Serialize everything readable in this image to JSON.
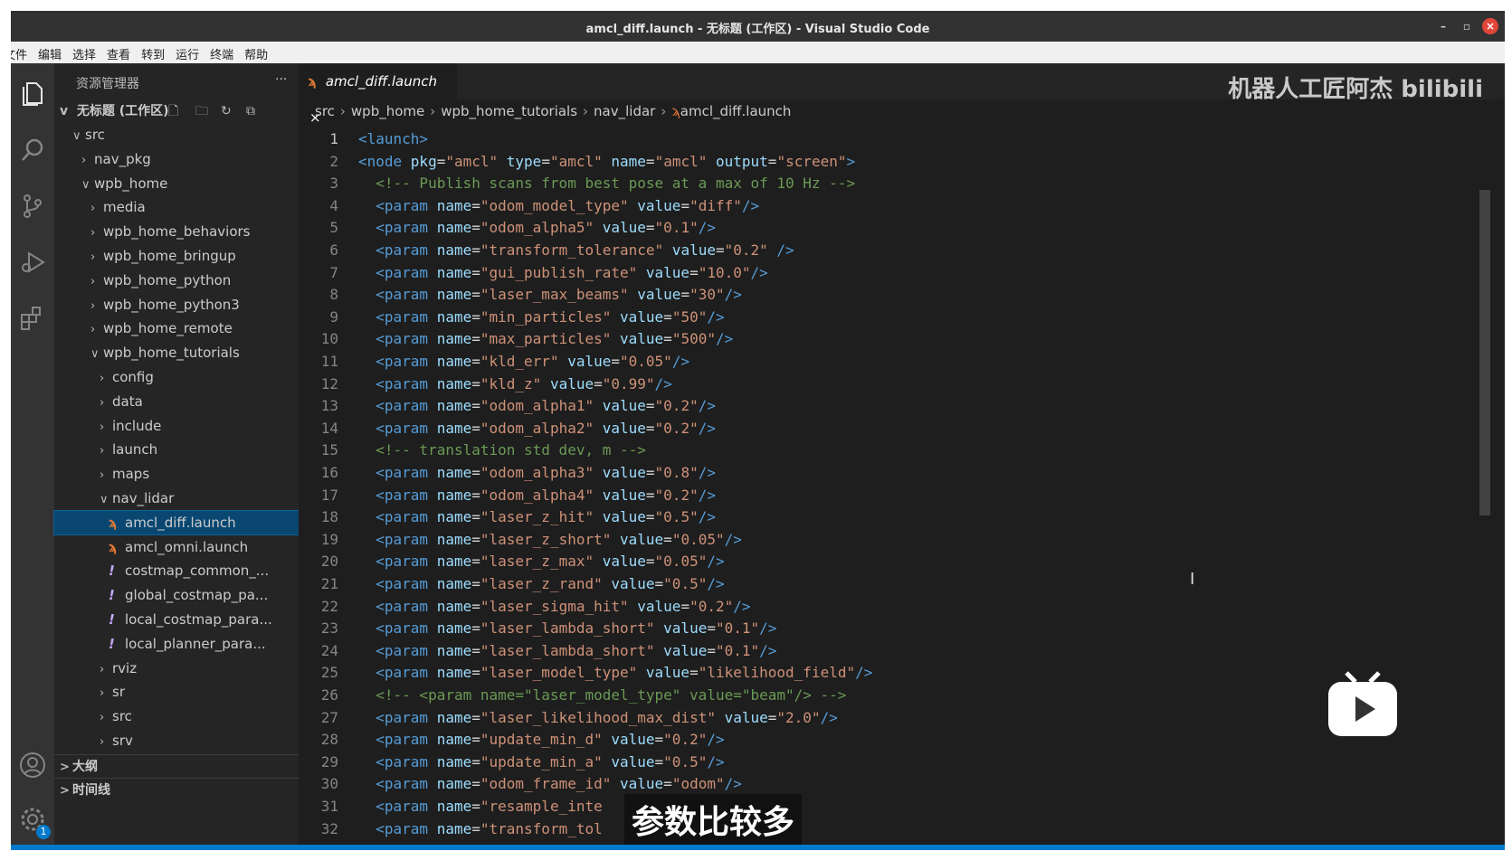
{
  "window": {
    "title": "amcl_diff.launch - 无标题 (工作区) - Visual Studio Code"
  },
  "menubar": {
    "items": [
      "文件",
      "编辑",
      "选择",
      "查看",
      "转到",
      "运行",
      "终端",
      "帮助"
    ]
  },
  "sidebar": {
    "title": "资源管理器",
    "more": "···",
    "workspace": "无标题 (工作区)",
    "tree": [
      {
        "label": "src",
        "chev": "v",
        "indent": 1
      },
      {
        "label": "nav_pkg",
        "chev": ">",
        "indent": 2
      },
      {
        "label": "wpb_home",
        "chev": "v",
        "indent": 2
      },
      {
        "label": "media",
        "chev": ">",
        "indent": 3
      },
      {
        "label": "wpb_home_behaviors",
        "chev": ">",
        "indent": 3
      },
      {
        "label": "wpb_home_bringup",
        "chev": ">",
        "indent": 3
      },
      {
        "label": "wpb_home_python",
        "chev": ">",
        "indent": 3
      },
      {
        "label": "wpb_home_python3",
        "chev": ">",
        "indent": 3
      },
      {
        "label": "wpb_home_remote",
        "chev": ">",
        "indent": 3
      },
      {
        "label": "wpb_home_tutorials",
        "chev": "v",
        "indent": 3
      },
      {
        "label": "config",
        "chev": ">",
        "indent": 4
      },
      {
        "label": "data",
        "chev": ">",
        "indent": 4
      },
      {
        "label": "include",
        "chev": ">",
        "indent": 4
      },
      {
        "label": "launch",
        "chev": ">",
        "indent": 4
      },
      {
        "label": "maps",
        "chev": ">",
        "indent": 4
      },
      {
        "label": "nav_lidar",
        "chev": "v",
        "indent": 4
      },
      {
        "label": "amcl_diff.launch",
        "icon": "rss",
        "indent": 5,
        "selected": true
      },
      {
        "label": "amcl_omni.launch",
        "icon": "rss",
        "indent": 5
      },
      {
        "label": "costmap_common_...",
        "icon": "!",
        "indent": 5
      },
      {
        "label": "global_costmap_pa...",
        "icon": "!",
        "indent": 5
      },
      {
        "label": "local_costmap_para...",
        "icon": "!",
        "indent": 5
      },
      {
        "label": "local_planner_para...",
        "icon": "!",
        "indent": 5
      },
      {
        "label": "rviz",
        "chev": ">",
        "indent": 4
      },
      {
        "label": "sr",
        "chev": ">",
        "indent": 4
      },
      {
        "label": "src",
        "chev": ">",
        "indent": 4
      },
      {
        "label": "srv",
        "chev": ">",
        "indent": 4
      }
    ],
    "outline": "大纲",
    "timeline": "时间线"
  },
  "activity": {
    "badge": "1"
  },
  "editor": {
    "tab_label": "amcl_diff.launch",
    "tab_close": "×",
    "breadcrumb": [
      "src",
      "wpb_home",
      "wpb_home_tutorials",
      "nav_lidar",
      "amcl_diff.launch"
    ],
    "lines": [
      [
        [
          "tg",
          "<launch>"
        ]
      ],
      [
        [
          "tg",
          "<node "
        ],
        [
          "at",
          "pkg"
        ],
        [
          "eq",
          "="
        ],
        [
          "st",
          "\"amcl\""
        ],
        [
          "at",
          " type"
        ],
        [
          "eq",
          "="
        ],
        [
          "st",
          "\"amcl\""
        ],
        [
          "at",
          " name"
        ],
        [
          "eq",
          "="
        ],
        [
          "st",
          "\"amcl\""
        ],
        [
          "at",
          " output"
        ],
        [
          "eq",
          "="
        ],
        [
          "st",
          "\"screen\""
        ],
        [
          "tg",
          ">"
        ]
      ],
      [
        [
          "cm",
          "  <!-- Publish scans from best pose at a max of 10 Hz -->"
        ]
      ],
      [
        [
          "tg",
          "  <param "
        ],
        [
          "at",
          "name"
        ],
        [
          "eq",
          "="
        ],
        [
          "st",
          "\"odom_model_type\""
        ],
        [
          "at",
          " value"
        ],
        [
          "eq",
          "="
        ],
        [
          "st",
          "\"diff\""
        ],
        [
          "tg",
          "/>"
        ]
      ],
      [
        [
          "tg",
          "  <param "
        ],
        [
          "at",
          "name"
        ],
        [
          "eq",
          "="
        ],
        [
          "st",
          "\"odom_alpha5\""
        ],
        [
          "at",
          " value"
        ],
        [
          "eq",
          "="
        ],
        [
          "st",
          "\"0.1\""
        ],
        [
          "tg",
          "/>"
        ]
      ],
      [
        [
          "tg",
          "  <param "
        ],
        [
          "at",
          "name"
        ],
        [
          "eq",
          "="
        ],
        [
          "st",
          "\"transform_tolerance\""
        ],
        [
          "at",
          " value"
        ],
        [
          "eq",
          "="
        ],
        [
          "st",
          "\"0.2\""
        ],
        [
          "tg",
          " />"
        ]
      ],
      [
        [
          "tg",
          "  <param "
        ],
        [
          "at",
          "name"
        ],
        [
          "eq",
          "="
        ],
        [
          "st",
          "\"gui_publish_rate\""
        ],
        [
          "at",
          " value"
        ],
        [
          "eq",
          "="
        ],
        [
          "st",
          "\"10.0\""
        ],
        [
          "tg",
          "/>"
        ]
      ],
      [
        [
          "tg",
          "  <param "
        ],
        [
          "at",
          "name"
        ],
        [
          "eq",
          "="
        ],
        [
          "st",
          "\"laser_max_beams\""
        ],
        [
          "at",
          " value"
        ],
        [
          "eq",
          "="
        ],
        [
          "st",
          "\"30\""
        ],
        [
          "tg",
          "/>"
        ]
      ],
      [
        [
          "tg",
          "  <param "
        ],
        [
          "at",
          "name"
        ],
        [
          "eq",
          "="
        ],
        [
          "st",
          "\"min_particles\""
        ],
        [
          "at",
          " value"
        ],
        [
          "eq",
          "="
        ],
        [
          "st",
          "\"50\""
        ],
        [
          "tg",
          "/>"
        ]
      ],
      [
        [
          "tg",
          "  <param "
        ],
        [
          "at",
          "name"
        ],
        [
          "eq",
          "="
        ],
        [
          "st",
          "\"max_particles\""
        ],
        [
          "at",
          " value"
        ],
        [
          "eq",
          "="
        ],
        [
          "st",
          "\"500\""
        ],
        [
          "tg",
          "/>"
        ]
      ],
      [
        [
          "tg",
          "  <param "
        ],
        [
          "at",
          "name"
        ],
        [
          "eq",
          "="
        ],
        [
          "st",
          "\"kld_err\""
        ],
        [
          "at",
          " value"
        ],
        [
          "eq",
          "="
        ],
        [
          "st",
          "\"0.05\""
        ],
        [
          "tg",
          "/>"
        ]
      ],
      [
        [
          "tg",
          "  <param "
        ],
        [
          "at",
          "name"
        ],
        [
          "eq",
          "="
        ],
        [
          "st",
          "\"kld_z\""
        ],
        [
          "at",
          " value"
        ],
        [
          "eq",
          "="
        ],
        [
          "st",
          "\"0.99\""
        ],
        [
          "tg",
          "/>"
        ]
      ],
      [
        [
          "tg",
          "  <param "
        ],
        [
          "at",
          "name"
        ],
        [
          "eq",
          "="
        ],
        [
          "st",
          "\"odom_alpha1\""
        ],
        [
          "at",
          " value"
        ],
        [
          "eq",
          "="
        ],
        [
          "st",
          "\"0.2\""
        ],
        [
          "tg",
          "/>"
        ]
      ],
      [
        [
          "tg",
          "  <param "
        ],
        [
          "at",
          "name"
        ],
        [
          "eq",
          "="
        ],
        [
          "st",
          "\"odom_alpha2\""
        ],
        [
          "at",
          " value"
        ],
        [
          "eq",
          "="
        ],
        [
          "st",
          "\"0.2\""
        ],
        [
          "tg",
          "/>"
        ]
      ],
      [
        [
          "cm",
          "  <!-- translation std dev, m -->"
        ]
      ],
      [
        [
          "tg",
          "  <param "
        ],
        [
          "at",
          "name"
        ],
        [
          "eq",
          "="
        ],
        [
          "st",
          "\"odom_alpha3\""
        ],
        [
          "at",
          " value"
        ],
        [
          "eq",
          "="
        ],
        [
          "st",
          "\"0.8\""
        ],
        [
          "tg",
          "/>"
        ]
      ],
      [
        [
          "tg",
          "  <param "
        ],
        [
          "at",
          "name"
        ],
        [
          "eq",
          "="
        ],
        [
          "st",
          "\"odom_alpha4\""
        ],
        [
          "at",
          " value"
        ],
        [
          "eq",
          "="
        ],
        [
          "st",
          "\"0.2\""
        ],
        [
          "tg",
          "/>"
        ]
      ],
      [
        [
          "tg",
          "  <param "
        ],
        [
          "at",
          "name"
        ],
        [
          "eq",
          "="
        ],
        [
          "st",
          "\"laser_z_hit\""
        ],
        [
          "at",
          " value"
        ],
        [
          "eq",
          "="
        ],
        [
          "st",
          "\"0.5\""
        ],
        [
          "tg",
          "/>"
        ]
      ],
      [
        [
          "tg",
          "  <param "
        ],
        [
          "at",
          "name"
        ],
        [
          "eq",
          "="
        ],
        [
          "st",
          "\"laser_z_short\""
        ],
        [
          "at",
          " value"
        ],
        [
          "eq",
          "="
        ],
        [
          "st",
          "\"0.05\""
        ],
        [
          "tg",
          "/>"
        ]
      ],
      [
        [
          "tg",
          "  <param "
        ],
        [
          "at",
          "name"
        ],
        [
          "eq",
          "="
        ],
        [
          "st",
          "\"laser_z_max\""
        ],
        [
          "at",
          " value"
        ],
        [
          "eq",
          "="
        ],
        [
          "st",
          "\"0.05\""
        ],
        [
          "tg",
          "/>"
        ]
      ],
      [
        [
          "tg",
          "  <param "
        ],
        [
          "at",
          "name"
        ],
        [
          "eq",
          "="
        ],
        [
          "st",
          "\"laser_z_rand\""
        ],
        [
          "at",
          " value"
        ],
        [
          "eq",
          "="
        ],
        [
          "st",
          "\"0.5\""
        ],
        [
          "tg",
          "/>"
        ]
      ],
      [
        [
          "tg",
          "  <param "
        ],
        [
          "at",
          "name"
        ],
        [
          "eq",
          "="
        ],
        [
          "st",
          "\"laser_sigma_hit\""
        ],
        [
          "at",
          " value"
        ],
        [
          "eq",
          "="
        ],
        [
          "st",
          "\"0.2\""
        ],
        [
          "tg",
          "/>"
        ]
      ],
      [
        [
          "tg",
          "  <param "
        ],
        [
          "at",
          "name"
        ],
        [
          "eq",
          "="
        ],
        [
          "st",
          "\"laser_lambda_short\""
        ],
        [
          "at",
          " value"
        ],
        [
          "eq",
          "="
        ],
        [
          "st",
          "\"0.1\""
        ],
        [
          "tg",
          "/>"
        ]
      ],
      [
        [
          "tg",
          "  <param "
        ],
        [
          "at",
          "name"
        ],
        [
          "eq",
          "="
        ],
        [
          "st",
          "\"laser_lambda_short\""
        ],
        [
          "at",
          " value"
        ],
        [
          "eq",
          "="
        ],
        [
          "st",
          "\"0.1\""
        ],
        [
          "tg",
          "/>"
        ]
      ],
      [
        [
          "tg",
          "  <param "
        ],
        [
          "at",
          "name"
        ],
        [
          "eq",
          "="
        ],
        [
          "st",
          "\"laser_model_type\""
        ],
        [
          "at",
          " value"
        ],
        [
          "eq",
          "="
        ],
        [
          "st",
          "\"likelihood_field\""
        ],
        [
          "tg",
          "/>"
        ]
      ],
      [
        [
          "cm",
          "  <!-- <param name=\"laser_model_type\" value=\"beam\"/> -->"
        ]
      ],
      [
        [
          "tg",
          "  <param "
        ],
        [
          "at",
          "name"
        ],
        [
          "eq",
          "="
        ],
        [
          "st",
          "\"laser_likelihood_max_dist\""
        ],
        [
          "at",
          " value"
        ],
        [
          "eq",
          "="
        ],
        [
          "st",
          "\"2.0\""
        ],
        [
          "tg",
          "/>"
        ]
      ],
      [
        [
          "tg",
          "  <param "
        ],
        [
          "at",
          "name"
        ],
        [
          "eq",
          "="
        ],
        [
          "st",
          "\"update_min_d\""
        ],
        [
          "at",
          " value"
        ],
        [
          "eq",
          "="
        ],
        [
          "st",
          "\"0.2\""
        ],
        [
          "tg",
          "/>"
        ]
      ],
      [
        [
          "tg",
          "  <param "
        ],
        [
          "at",
          "name"
        ],
        [
          "eq",
          "="
        ],
        [
          "st",
          "\"update_min_a\""
        ],
        [
          "at",
          " value"
        ],
        [
          "eq",
          "="
        ],
        [
          "st",
          "\"0.5\""
        ],
        [
          "tg",
          "/>"
        ]
      ],
      [
        [
          "tg",
          "  <param "
        ],
        [
          "at",
          "name"
        ],
        [
          "eq",
          "="
        ],
        [
          "st",
          "\"odom_frame_id\""
        ],
        [
          "at",
          " value"
        ],
        [
          "eq",
          "="
        ],
        [
          "st",
          "\"odom\""
        ],
        [
          "tg",
          "/>"
        ]
      ],
      [
        [
          "tg",
          "  <param "
        ],
        [
          "at",
          "name"
        ],
        [
          "eq",
          "="
        ],
        [
          "st",
          "\"resample_inte"
        ]
      ],
      [
        [
          "tg",
          "  <param "
        ],
        [
          "at",
          "name"
        ],
        [
          "eq",
          "="
        ],
        [
          "st",
          "\"transform_tol"
        ]
      ]
    ]
  },
  "overlay": {
    "watermark": "机器人工匠阿杰 bilibili",
    "subtitle": "参数比较多",
    "cursor": "I"
  }
}
